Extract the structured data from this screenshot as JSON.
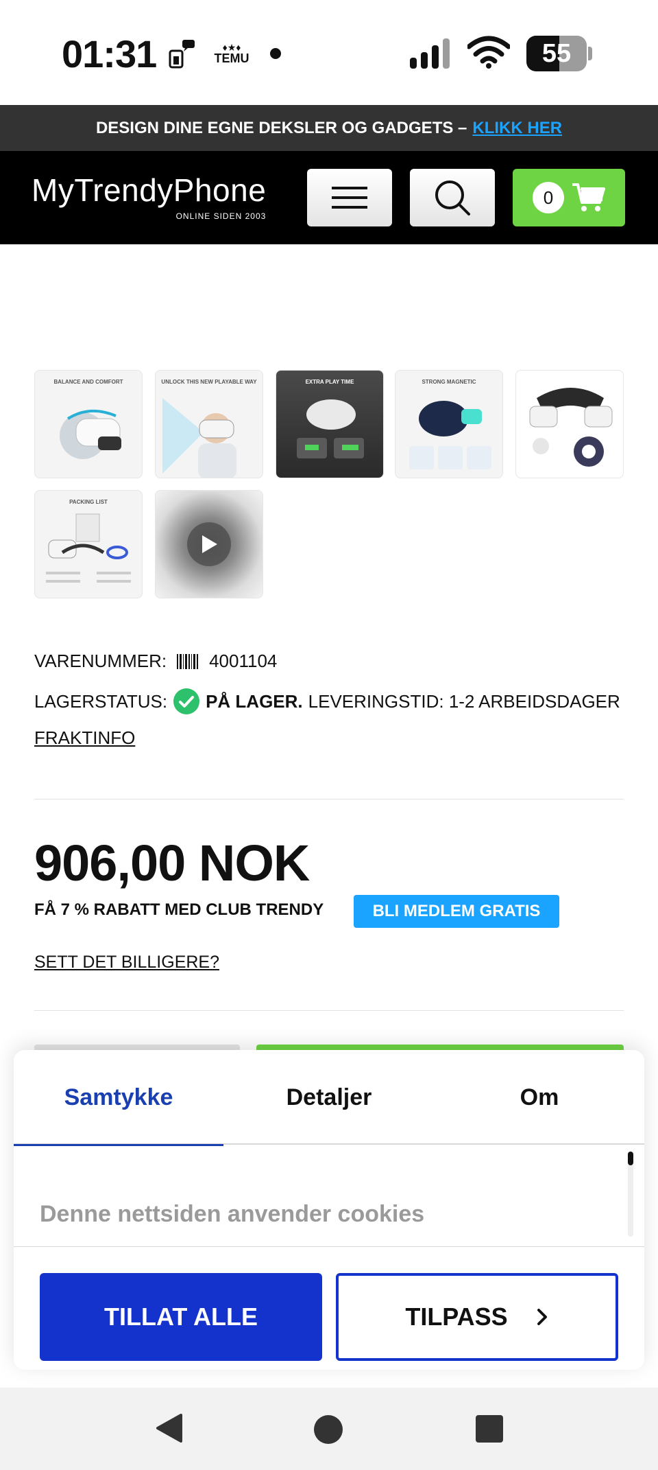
{
  "status_bar": {
    "time": "01:31",
    "notif_temu": "TEMU",
    "battery_level": "55"
  },
  "promo": {
    "text": "DESIGN DINE EGNE DEKSLER OG GADGETS –",
    "link": "KLIKK HER"
  },
  "header": {
    "logo": "MyTrendyPhone",
    "logo_sub": "ONLINE SIDEN 2003",
    "cart_count": "0"
  },
  "thumbnails": [
    {
      "caption": "BALANCE AND COMFORT"
    },
    {
      "caption": "UNLOCK THIS NEW PLAYABLE WAY"
    },
    {
      "caption": "EXTRA PLAY TIME"
    },
    {
      "caption": "STRONG MAGNETIC"
    },
    {
      "caption": ""
    },
    {
      "caption": "PACKING LIST"
    },
    {
      "caption": ""
    }
  ],
  "product": {
    "sku_label": "VARENUMMER:",
    "sku": "4001104",
    "stock_label": "LAGERSTATUS:",
    "stock_value": "PÅ LAGER.",
    "delivery": "LEVERINGSTID: 1-2 ARBEIDSDAGER",
    "shipping_link": "FRAKTINFO",
    "price": "906,00 NOK",
    "club_text": "FÅ 7 % RABATT MED CLUB TRENDY",
    "club_button": "BLI MEDLEM GRATIS",
    "cheaper_link": "SETT DET BILLIGERE?"
  },
  "cookie_dialog": {
    "tabs": [
      "Samtykke",
      "Detaljer",
      "Om"
    ],
    "heading": "Denne nettsiden anvender cookies",
    "allow_all": "TILLAT ALLE",
    "customize": "TILPASS"
  },
  "colors": {
    "promo_bg": "#333333",
    "header_bg": "#000000",
    "cart_green": "#6ed444",
    "link_blue": "#1aa3ff",
    "cookie_blue": "#1433cc",
    "tab_active": "#1a3fb0"
  }
}
